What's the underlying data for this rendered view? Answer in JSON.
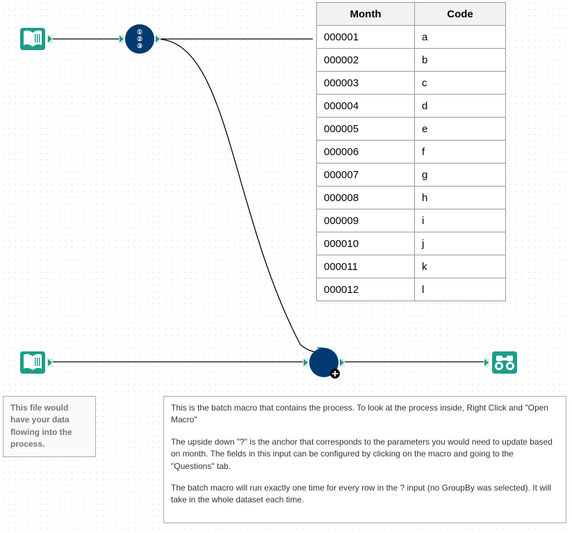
{
  "table": {
    "headers": [
      "Month",
      "Code"
    ],
    "rows": [
      {
        "month": "000001",
        "code": "a"
      },
      {
        "month": "000002",
        "code": "b"
      },
      {
        "month": "000003",
        "code": "c"
      },
      {
        "month": "000004",
        "code": "d"
      },
      {
        "month": "000005",
        "code": "e"
      },
      {
        "month": "000006",
        "code": "f"
      },
      {
        "month": "000007",
        "code": "g"
      },
      {
        "month": "000008",
        "code": "h"
      },
      {
        "month": "000009",
        "code": "i"
      },
      {
        "month": "000010",
        "code": "j"
      },
      {
        "month": "000011",
        "code": "k"
      },
      {
        "month": "000012",
        "code": "l"
      }
    ]
  },
  "comments": {
    "left": "This file would have your data flowing into the process.",
    "right_p1": "This is the batch macro that contains the process. To look at the process inside, Right Click and \"Open Macro\"",
    "right_p2": "The upside down \"?\" is the anchor that corresponds to the parameters you would need to update based on month. The fields in this input can be configured by clicking on the macro and going to the \"Questions\" tab.",
    "right_p3": "The batch macro will run exactly one time for every row in the ? input (no GroupBy was selected). It will take in the whole dataset each time."
  },
  "tools": {
    "text_input_1": "text-input",
    "text_input_2": "text-input",
    "record_id": "record-id",
    "batch_macro": "batch-macro",
    "browse": "browse"
  }
}
